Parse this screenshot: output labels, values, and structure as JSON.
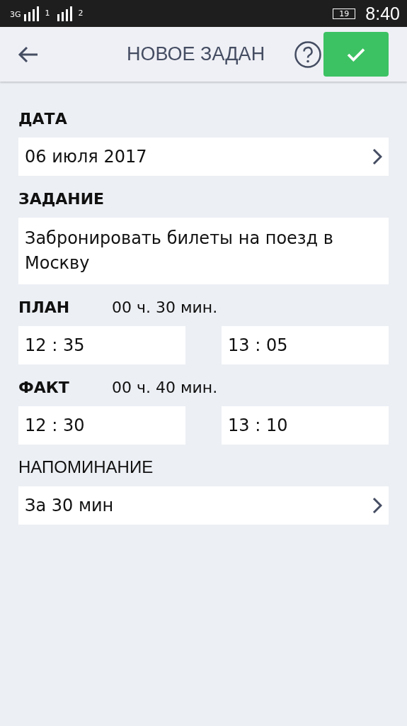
{
  "status_bar": {
    "network": "3G",
    "sim_1": "1",
    "sim_2": "2",
    "battery": "19",
    "time": "8:40"
  },
  "app_bar": {
    "title": "НОВОЕ ЗАДАН"
  },
  "sections": [
    {
      "kind": "select",
      "label": "ДАТА",
      "value": "06 июля 2017"
    },
    {
      "kind": "text",
      "label": "ЗАДАНИЕ",
      "value": "Забронировать билеты на поезд в Москву"
    },
    {
      "kind": "time_range",
      "label": "ПЛАН",
      "duration": "00 ч. 30 мин.",
      "start": "12 : 35",
      "end": "13 : 05"
    },
    {
      "kind": "time_range",
      "label": "ФАКТ",
      "duration": "00 ч. 40 мин.",
      "start": "12 : 30",
      "end": "13 : 10"
    },
    {
      "kind": "select",
      "label": "НАПОМИНАНИЕ",
      "value": "За 30 мин",
      "light_label": true
    }
  ]
}
